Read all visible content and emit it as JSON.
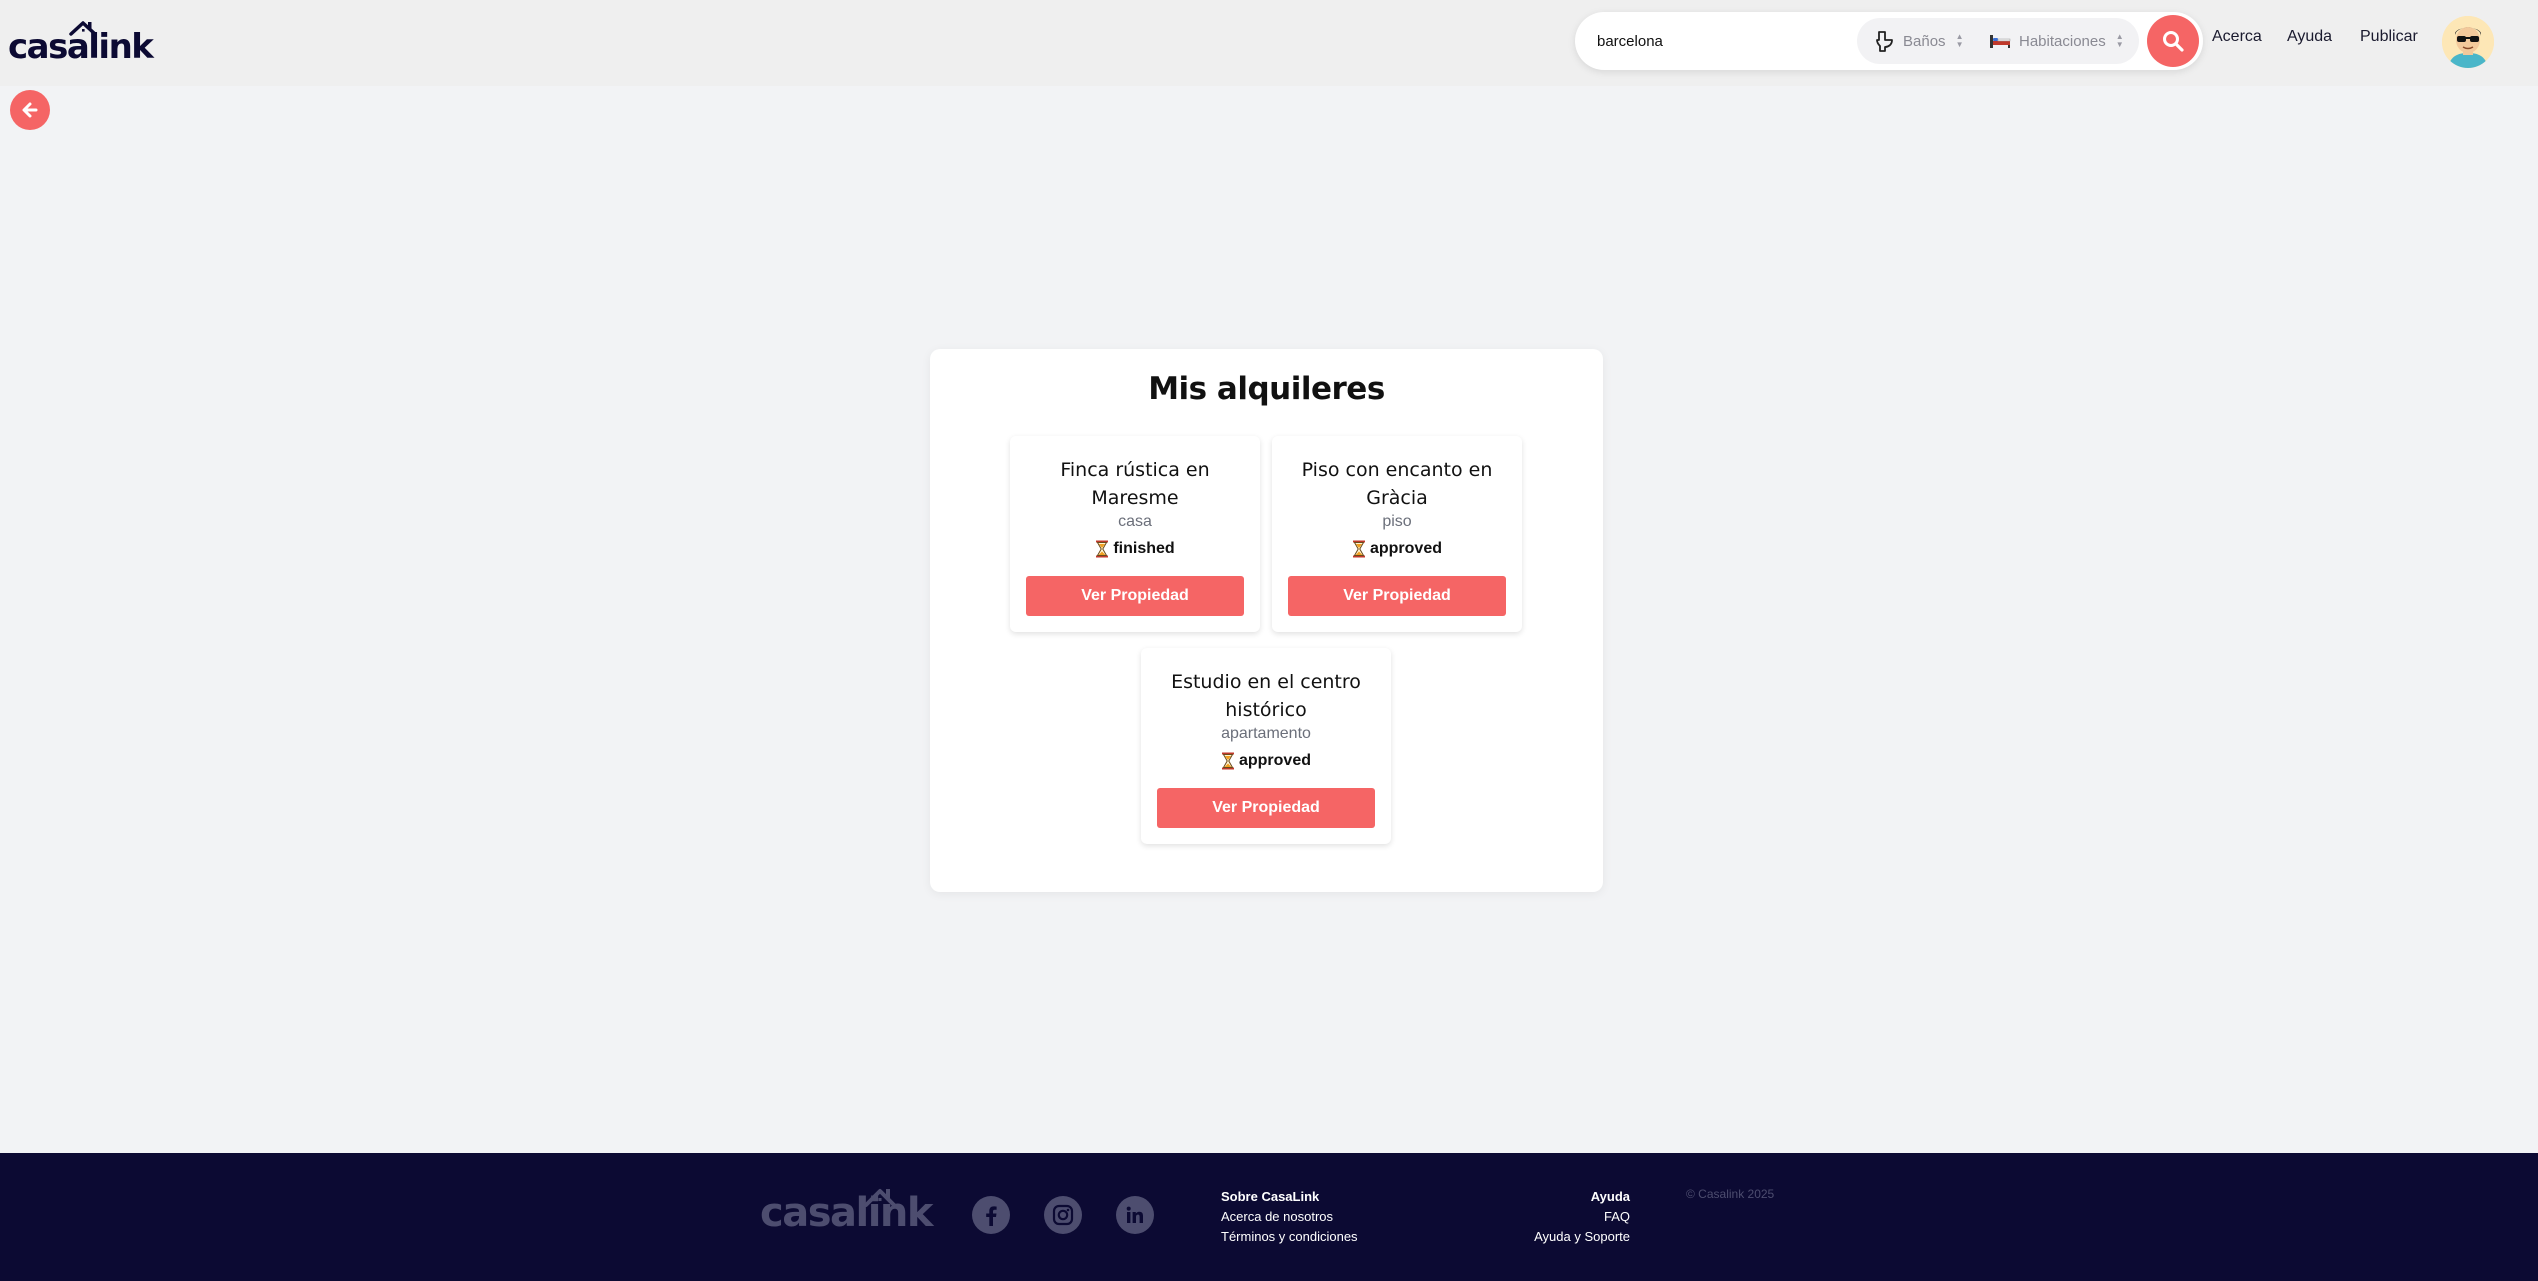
{
  "header": {
    "logo_text": "casalink",
    "search": {
      "value": "barcelona",
      "placeholder": ""
    },
    "filters": {
      "baths_placeholder": "Baños",
      "rooms_placeholder": "Habitaciones"
    },
    "nav": {
      "acerca": "Acerca",
      "ayuda": "Ayuda",
      "publicar": "Publicar"
    }
  },
  "main": {
    "title": "Mis alquileres",
    "rentals": [
      {
        "title": "Finca rústica en Maresme",
        "type": "casa",
        "status": "finished",
        "status_icon": "hourglass-icon",
        "button": "Ver Propiedad"
      },
      {
        "title": "Piso con encanto en Gràcia",
        "type": "piso",
        "status": "approved",
        "status_icon": "hourglass-icon",
        "button": "Ver Propiedad"
      },
      {
        "title": "Estudio en el centro histórico",
        "type": "apartamento",
        "status": "approved",
        "status_icon": "hourglass-icon",
        "button": "Ver Propiedad"
      }
    ]
  },
  "footer": {
    "logo_text": "casalink",
    "social": [
      "facebook-icon",
      "instagram-icon",
      "linkedin-icon"
    ],
    "about": {
      "heading": "Sobre CasaLink",
      "links": [
        "Acerca de nosotros",
        "Términos y condiciones"
      ]
    },
    "help": {
      "heading": "Ayuda",
      "links": [
        "FAQ",
        "Ayuda y Soporte"
      ]
    },
    "copyright": "© Casalink 2025"
  },
  "colors": {
    "accent": "#f56565",
    "brand_dark": "#0c0a33",
    "background": "#f2f3f5"
  }
}
